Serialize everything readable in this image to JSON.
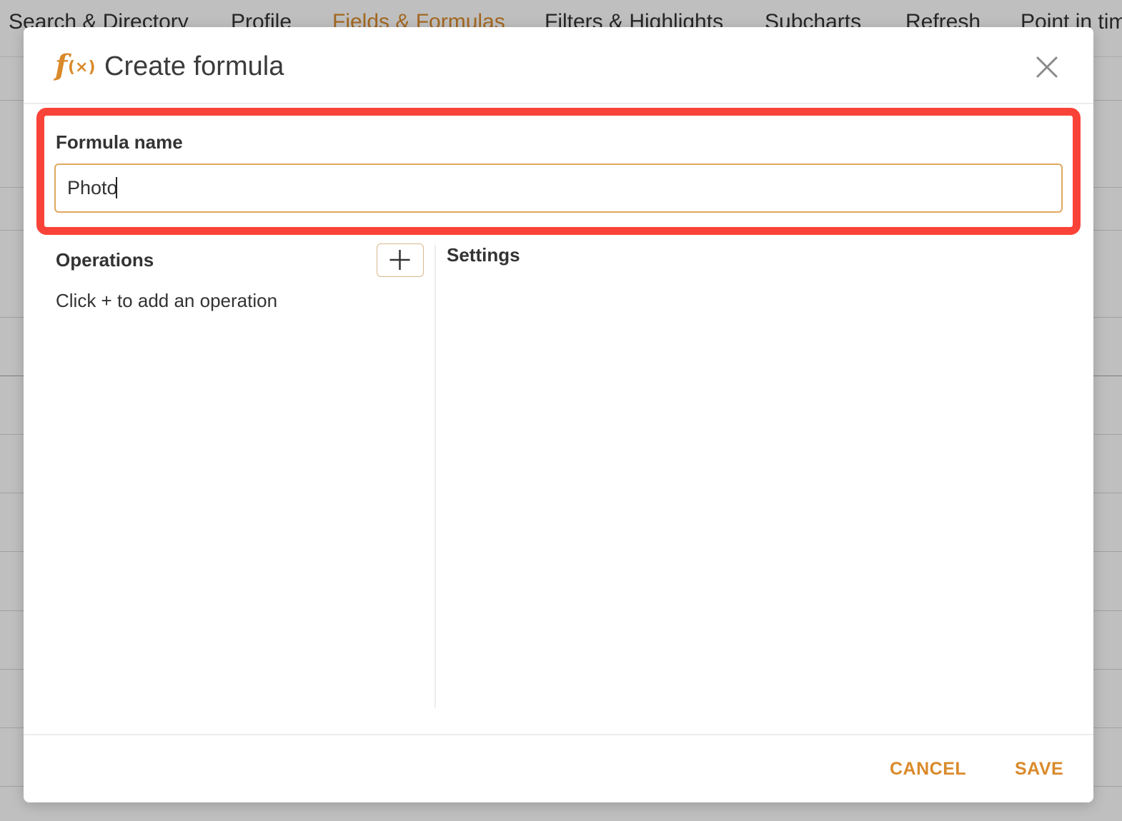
{
  "background_tabs": [
    {
      "label": "Search & Directory",
      "active": false
    },
    {
      "label": "Profile",
      "active": false
    },
    {
      "label": "Fields & Formulas",
      "active": true
    },
    {
      "label": "Filters & Highlights",
      "active": false
    },
    {
      "label": "Subcharts",
      "active": false
    },
    {
      "label": "Refresh",
      "active": false
    },
    {
      "label": "Point in tim",
      "active": false
    }
  ],
  "modal": {
    "icon": "function-fx-icon",
    "title": "Create formula",
    "close_icon": "close-icon"
  },
  "formula_name": {
    "label": "Formula name",
    "value": "Photo"
  },
  "operations": {
    "title": "Operations",
    "add_icon": "plus-icon",
    "empty_text": "Click + to add an operation"
  },
  "settings": {
    "title": "Settings"
  },
  "footer": {
    "cancel_label": "CANCEL",
    "save_label": "SAVE"
  },
  "colors": {
    "accent": "#d98a2b",
    "highlight": "#fa4338",
    "input_border": "#e0a85f"
  }
}
